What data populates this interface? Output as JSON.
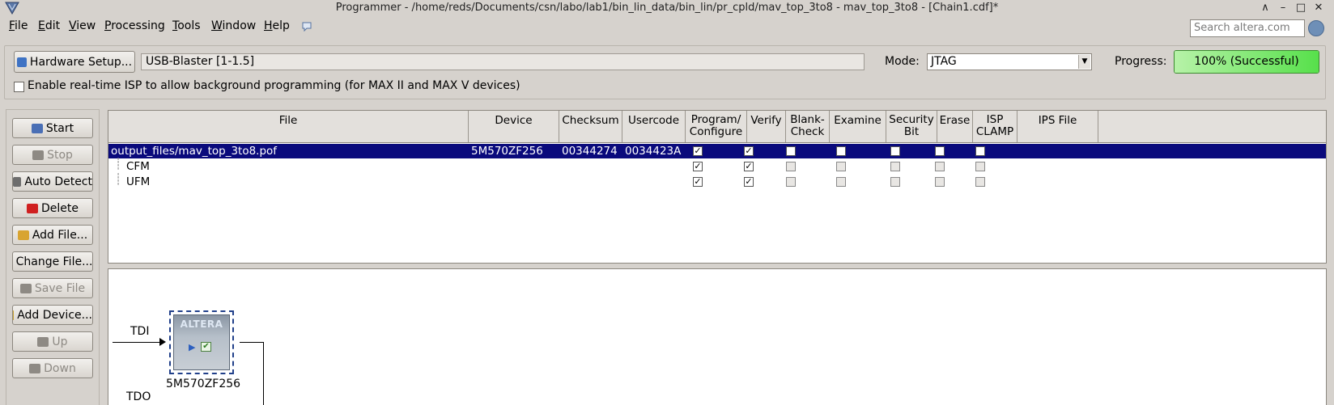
{
  "window": {
    "title": "Programmer - /home/reds/Documents/csn/labo/lab1/bin_lin_data/bin_lin/pr_cpld/mav_top_3to8 - mav_top_3to8 - [Chain1.cdf]*"
  },
  "menu": {
    "items": [
      {
        "first": "F",
        "rest": "ile"
      },
      {
        "first": "E",
        "rest": "dit"
      },
      {
        "first": "V",
        "rest": "iew"
      },
      {
        "first": "P",
        "rest": "rocessing"
      },
      {
        "first": "T",
        "rest": "ools"
      },
      {
        "first": "W",
        "rest": "indow"
      },
      {
        "first": "H",
        "rest": "elp"
      }
    ],
    "search_placeholder": "Search altera.com"
  },
  "hardware": {
    "button_label": "Hardware Setup...",
    "value": "USB-Blaster [1-1.5]",
    "mode_label": "Mode:",
    "mode_value": "JTAG",
    "progress_label": "Progress:",
    "progress_text": "100% (Successful)",
    "progress_percent": 100,
    "isp_label": "Enable real-time ISP to allow background programming (for MAX II and MAX V devices)",
    "isp_checked": false
  },
  "side_buttons": [
    {
      "label": "Start",
      "enabled": true,
      "icon": "start-icon"
    },
    {
      "label": "Stop",
      "enabled": false,
      "icon": "stop-icon"
    },
    {
      "label": "Auto Detect",
      "enabled": true,
      "icon": "auto-detect-icon"
    },
    {
      "label": "Delete",
      "enabled": true,
      "icon": "delete-icon"
    },
    {
      "label": "Add File...",
      "enabled": true,
      "icon": "add-file-icon"
    },
    {
      "label": "Change File...",
      "enabled": true,
      "icon": "change-file-icon"
    },
    {
      "label": "Save File",
      "enabled": false,
      "icon": "save-file-icon"
    },
    {
      "label": "Add Device...",
      "enabled": true,
      "icon": "add-device-icon"
    },
    {
      "label": "Up",
      "enabled": false,
      "icon": "up-icon"
    },
    {
      "label": "Down",
      "enabled": false,
      "icon": "down-icon"
    }
  ],
  "table": {
    "headers": {
      "file": "File",
      "device": "Device",
      "checksum": "Checksum",
      "usercode": "Usercode",
      "program_1": "Program/",
      "program_2": "Configure",
      "verify": "Verify",
      "blank_1": "Blank-",
      "blank_2": "Check",
      "examine": "Examine",
      "security_1": "Security",
      "security_2": "Bit",
      "erase": "Erase",
      "isp_1": "ISP",
      "isp_2": "CLAMP",
      "ips_file": "IPS File"
    },
    "rows": [
      {
        "file": "output_files/mav_top_3to8.pof",
        "device": "5M570ZF256",
        "checksum": "00344274",
        "usercode": "0034423A",
        "selected": true,
        "checks": [
          true,
          true,
          false,
          false,
          false,
          false,
          false
        ]
      },
      {
        "file": "CFM",
        "device": "",
        "checksum": "",
        "usercode": "",
        "selected": false,
        "checks": [
          true,
          true,
          false,
          false,
          false,
          false,
          false
        ]
      },
      {
        "file": "UFM",
        "device": "",
        "checksum": "",
        "usercode": "",
        "selected": false,
        "checks": [
          true,
          true,
          false,
          false,
          false,
          false,
          false
        ]
      }
    ]
  },
  "chain": {
    "tdi_label": "TDI",
    "tdo_label": "TDO",
    "device_label": "5M570ZF256",
    "chip_logo": "ALTERA"
  },
  "colors": {
    "selection": "#0a0a7c",
    "progress_green": "#57e04b"
  }
}
